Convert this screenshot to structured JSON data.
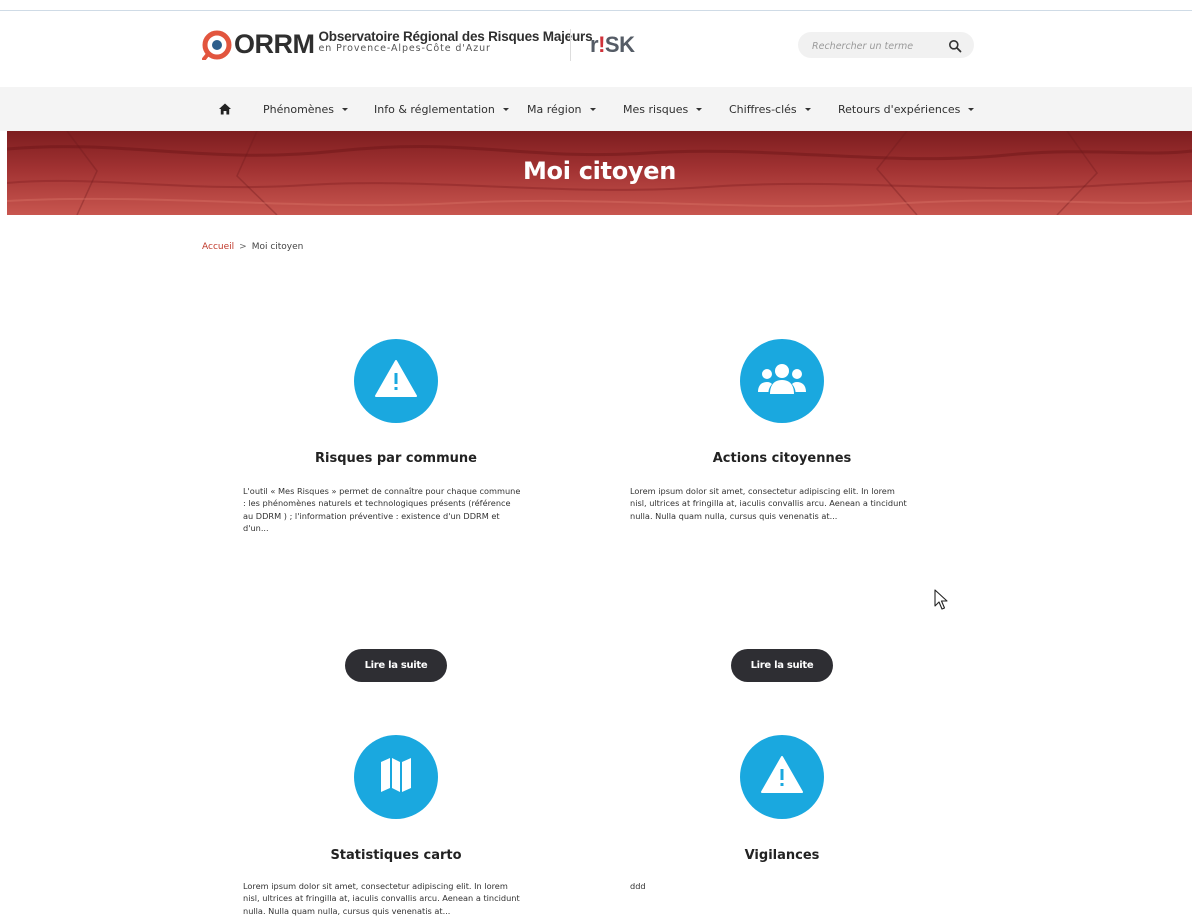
{
  "header": {
    "logo": {
      "acronym": "ORRM",
      "title": "Observatoire Régional des Risques Majeurs",
      "subtitle": "en Provence-Alpes-Côte d'Azur"
    },
    "partner_logo": {
      "prefix": "r",
      "bang": "!",
      "suffix": "SK"
    },
    "search": {
      "placeholder": "Rechercher un terme",
      "value": ""
    }
  },
  "nav": {
    "items": [
      {
        "label": "Phénomènes"
      },
      {
        "label": "Info & réglementation"
      },
      {
        "label": "Ma région"
      },
      {
        "label": "Mes risques"
      },
      {
        "label": "Chiffres-clés"
      },
      {
        "label": "Retours d'expériences"
      }
    ]
  },
  "banner": {
    "title": "Moi citoyen"
  },
  "breadcrumb": {
    "home": "Accueil",
    "separator": ">",
    "current": "Moi citoyen"
  },
  "cards": [
    {
      "icon": "warning-icon",
      "title": "Risques par commune",
      "lines": [
        "L'outil « Mes Risques » permet de connaître pour chaque commune",
        ": les phénomènes naturels et technologiques présents (référence",
        "au DDRM ) ; l'information préventive : existence d'un DDRM et",
        "d'un..."
      ],
      "button": "Lire la suite"
    },
    {
      "icon": "users-icon",
      "title": "Actions citoyennes",
      "lines": [
        "Lorem ipsum dolor sit amet, consectetur adipiscing elit. In lorem",
        "nisl, ultrices at fringilla at, iaculis convallis arcu. Aenean a tincidunt",
        "nulla. Nulla quam nulla, cursus quis venenatis at..."
      ],
      "button": "Lire la suite"
    },
    {
      "icon": "map-icon",
      "title": "Statistiques carto",
      "lines": [
        "Lorem ipsum dolor sit amet, consectetur adipiscing elit. In lorem",
        "nisl, ultrices at fringilla at, iaculis convallis arcu. Aenean a tincidunt",
        "nulla. Nulla quam nulla, cursus quis venenatis at..."
      ]
    },
    {
      "icon": "warning-icon",
      "title": "Vigilances",
      "lines": [
        "ddd"
      ]
    }
  ],
  "colors": {
    "accent": "#1aa8df",
    "button": "#2e2e33",
    "banner": "#a13232",
    "breadcrumb_link": "#c0392b"
  }
}
